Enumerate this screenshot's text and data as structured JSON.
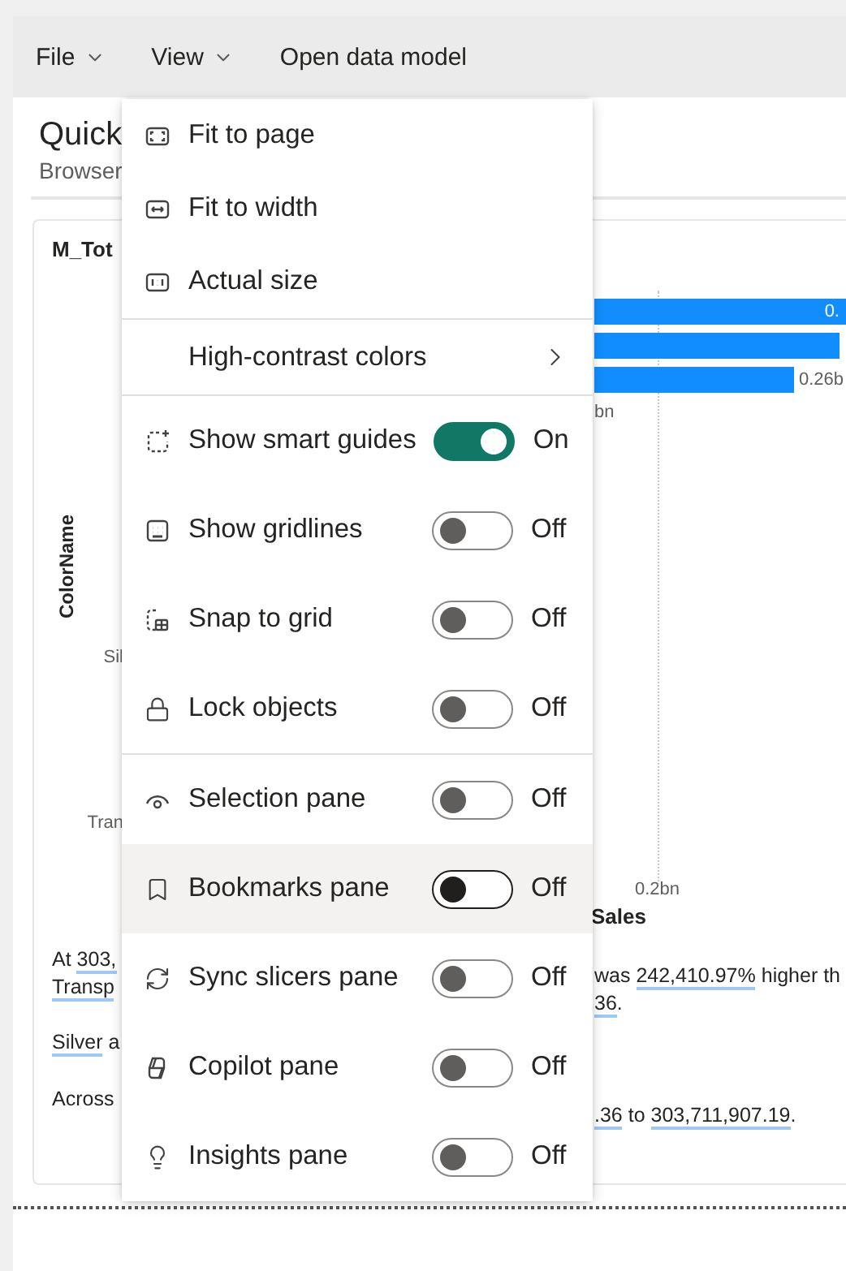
{
  "toolbar": {
    "menus": [
      {
        "label": "File"
      },
      {
        "label": "View"
      }
    ],
    "action": "Open data model"
  },
  "page": {
    "title": "Quick",
    "subtitle": "Browser"
  },
  "card": {
    "title": "M_Tot",
    "y_axis_title": "ColorName",
    "category_labels": [
      "Sil",
      "Tran"
    ],
    "bar_labels": [
      "0.",
      "0.26b"
    ],
    "x_tick_labels": [
      "bn",
      "0.2bn"
    ],
    "x_axis_title": "Sales"
  },
  "summary_left": [
    [
      {
        "t": "At "
      },
      {
        "t": "303,",
        "link": true
      }
    ],
    [
      {
        "t": "Transp",
        "link": true
      }
    ],
    [
      {
        "t": "Silver",
        "link": true
      },
      {
        "t": " a"
      }
    ],
    [
      {
        "t": "Across"
      }
    ]
  ],
  "summary_right": [
    [
      {
        "t": "was "
      },
      {
        "t": "242,410.97%",
        "link": true
      },
      {
        "t": " higher th"
      }
    ],
    [
      {
        "t": "36",
        "link": true
      },
      {
        "t": "."
      }
    ],
    [
      {
        "t": ".36",
        "link": true
      },
      {
        "t": " to "
      },
      {
        "t": "303,711,907.19",
        "link": true
      },
      {
        "t": "."
      }
    ]
  ],
  "menu": {
    "sections": [
      {
        "items": [
          {
            "kind": "command",
            "label": "Fit to page",
            "highlighted": false
          },
          {
            "kind": "command",
            "label": "Fit to width",
            "highlighted": false
          },
          {
            "kind": "command",
            "label": "Actual size",
            "highlighted": false
          }
        ]
      },
      {
        "items": [
          {
            "kind": "submenu",
            "label": "High-contrast colors",
            "highlighted": false
          }
        ]
      },
      {
        "items": [
          {
            "kind": "toggle",
            "label": "Show smart guides",
            "on": true,
            "state_label": "On",
            "highlighted": false
          },
          {
            "kind": "toggle",
            "label": "Show gridlines",
            "on": false,
            "state_label": "Off",
            "highlighted": false
          },
          {
            "kind": "toggle",
            "label": "Snap to grid",
            "on": false,
            "state_label": "Off",
            "highlighted": false
          },
          {
            "kind": "toggle",
            "label": "Lock objects",
            "on": false,
            "state_label": "Off",
            "highlighted": false
          }
        ]
      },
      {
        "items": [
          {
            "kind": "toggle",
            "label": "Selection pane",
            "on": false,
            "state_label": "Off",
            "highlighted": false
          },
          {
            "kind": "toggle",
            "label": "Bookmarks pane",
            "on": false,
            "state_label": "Off",
            "highlighted": true
          },
          {
            "kind": "toggle",
            "label": "Sync slicers pane",
            "on": false,
            "state_label": "Off",
            "highlighted": false
          },
          {
            "kind": "toggle",
            "label": "Copilot pane",
            "on": false,
            "state_label": "Off",
            "highlighted": false
          },
          {
            "kind": "toggle",
            "label": "Insights pane",
            "on": false,
            "state_label": "Off",
            "highlighted": false
          }
        ]
      }
    ]
  }
}
